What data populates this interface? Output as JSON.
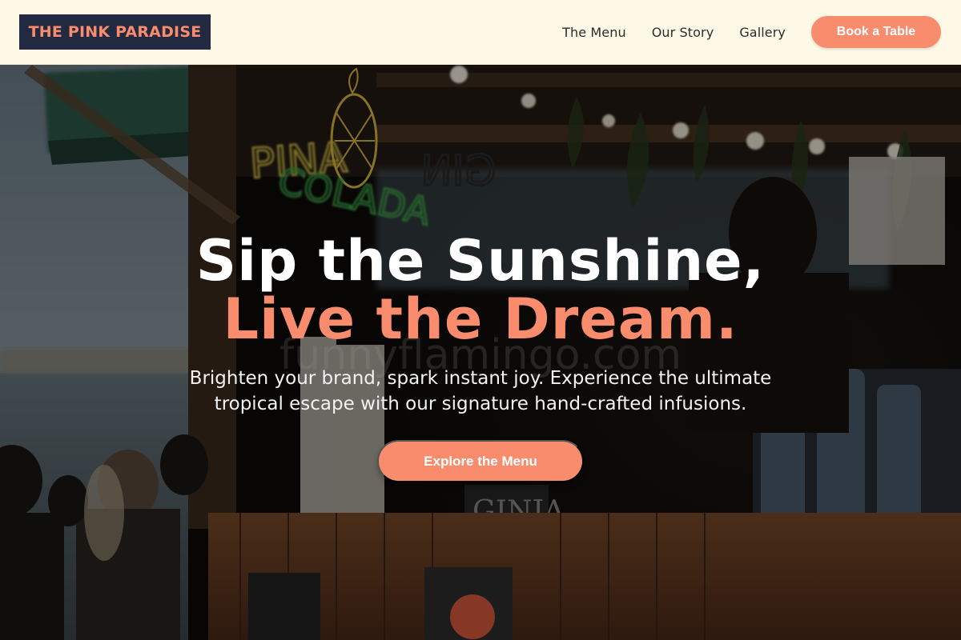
{
  "brand": {
    "logo_text": "THE PINK PARADISE",
    "accent": "#fa8c6e",
    "dark": "#222a42",
    "cream": "#fef9e7"
  },
  "nav": {
    "links": [
      "The Menu",
      "Our Story",
      "Gallery"
    ],
    "cta_label": "Book a Table"
  },
  "hero": {
    "headline_line1": "Sip the Sunshine,",
    "headline_line2": "Live the Dream.",
    "subtitle_line1": "Brighten your brand, spark instant joy. Experience the ultimate",
    "subtitle_line2": "tropical escape with our signature hand-crafted infusions.",
    "cta_label": "Explore the Menu"
  },
  "background_image": {
    "neon_signs": [
      "PINA",
      "COLADA",
      "GIN"
    ],
    "cup_print": "GINJA",
    "watermark": "funnyflamingo.com"
  }
}
